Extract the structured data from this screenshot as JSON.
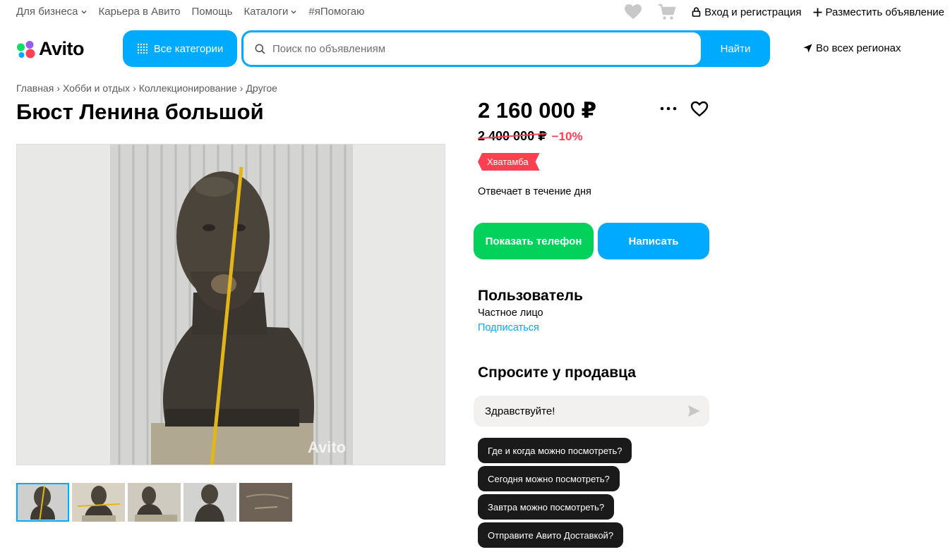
{
  "top_nav": {
    "items": [
      {
        "label": "Для бизнеса",
        "dropdown": true
      },
      {
        "label": "Карьера в Авито",
        "dropdown": false
      },
      {
        "label": "Помощь",
        "dropdown": false
      },
      {
        "label": "Каталоги",
        "dropdown": true
      },
      {
        "label": "#яПомогаю",
        "dropdown": false
      }
    ],
    "login_label": "Вход и регистрация",
    "post_ad_label": "Разместить объявление"
  },
  "header": {
    "logo_text": "Avito",
    "categories_label": "Все категории",
    "search_placeholder": "Поиск по объявлениям",
    "search_button": "Найти",
    "region_label": "Во всех регионах"
  },
  "breadcrumbs": [
    "Главная",
    "Хобби и отдых",
    "Коллекционирование",
    "Другое"
  ],
  "listing": {
    "title": "Бюст Ленина большой",
    "price": "2 160 000 ₽",
    "old_price": "2 400 000 ₽",
    "discount": "−10%",
    "badge": "Хватамба",
    "reply_time": "Отвечает в течение дня",
    "photo_watermark": "Avito",
    "thumbnail_count": 5
  },
  "actions": {
    "show_phone": "Показать телефон",
    "write": "Написать"
  },
  "seller": {
    "name": "Пользователь",
    "type": "Частное лицо",
    "subscribe": "Подписаться"
  },
  "ask_seller": {
    "title": "Спросите у продавца",
    "input_value": "Здравствуйте!",
    "quick_questions": [
      "Где и когда можно посмотреть?",
      "Сегодня можно посмотреть?",
      "Завтра можно посмотреть?",
      "Отправите Авито Доставкой?"
    ]
  },
  "colors": {
    "accent_blue": "#00aaff",
    "phone_green": "#02d15c",
    "discount_red": "#ff4053",
    "chip_dark": "#1a1a1a"
  },
  "icons": [
    "chevron-down-icon",
    "heart-icon",
    "cart-icon",
    "lock-icon",
    "plus-icon",
    "grid-dots-icon",
    "search-icon",
    "location-arrow-icon",
    "more-dots-icon",
    "favorite-heart-icon",
    "send-icon"
  ]
}
